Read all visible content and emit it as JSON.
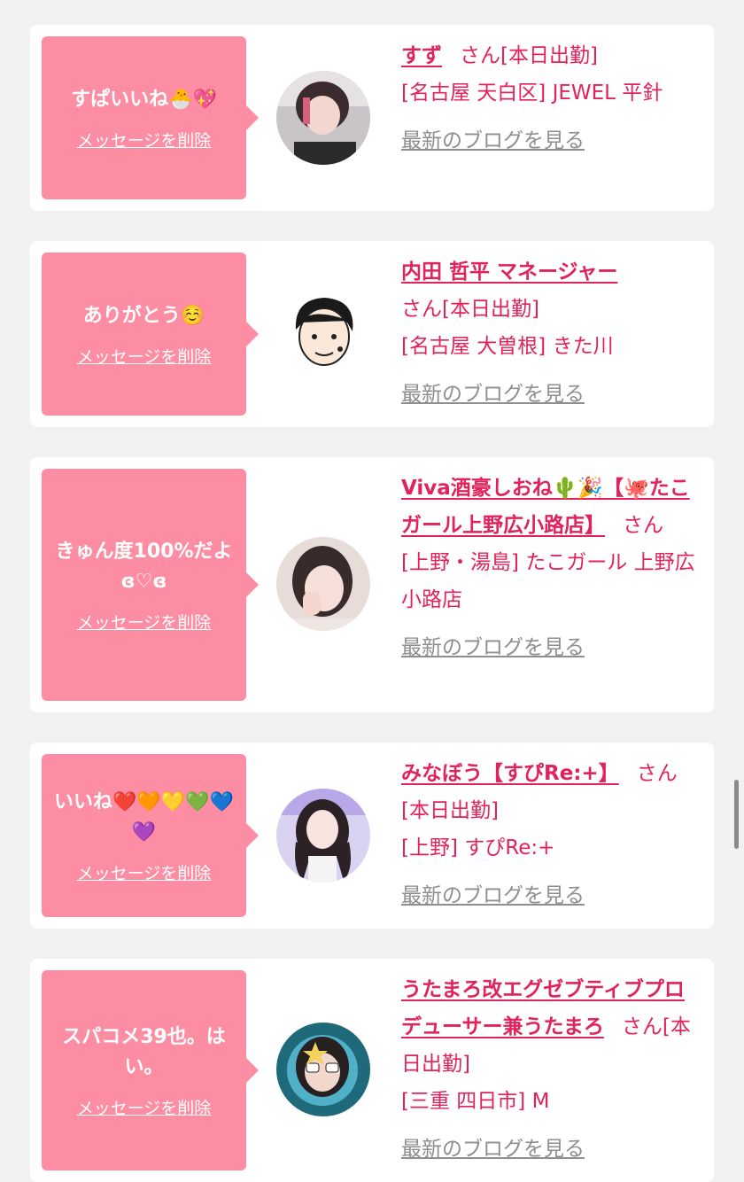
{
  "cards": [
    {
      "message": "すぱいいね🐣💖",
      "delete_label": "メッセージを削除",
      "name": "すず",
      "san": "さん[本日出勤]",
      "location": "[名古屋 天白区] JEWEL 平針",
      "blog_label": "最新のブログを見る"
    },
    {
      "message": "ありがとう☺️",
      "delete_label": "メッセージを削除",
      "name": "内田 哲平 マネージャー",
      "san": "さん[本日出勤]",
      "location": "[名古屋 大曽根] きた川",
      "blog_label": "最新のブログを見る"
    },
    {
      "message": "きゅん度100%だよɞ♡ɞ",
      "delete_label": "メッセージを削除",
      "name": "Viva酒豪しおね🌵🎉【🐙たこガール上野広小路店】",
      "san": "さん",
      "location": "[上野・湯島] たこガール 上野広小路店",
      "blog_label": "最新のブログを見る"
    },
    {
      "message": "いいね❤️🧡💛💚💙💜",
      "delete_label": "メッセージを削除",
      "name": "みなぼう【すぴRe:+】",
      "san": "さん[本日出勤]",
      "location": "[上野] すぴRe:+",
      "blog_label": "最新のブログを見る"
    },
    {
      "message": "スパコメ39也。はい。",
      "delete_label": "メッセージを削除",
      "name": "うたまろ改エグゼブティブプロデューサー兼うたまろ",
      "san": "さん[本日出勤]",
      "location": "[三重 四日市] M",
      "blog_label": "最新のブログを見る"
    }
  ]
}
